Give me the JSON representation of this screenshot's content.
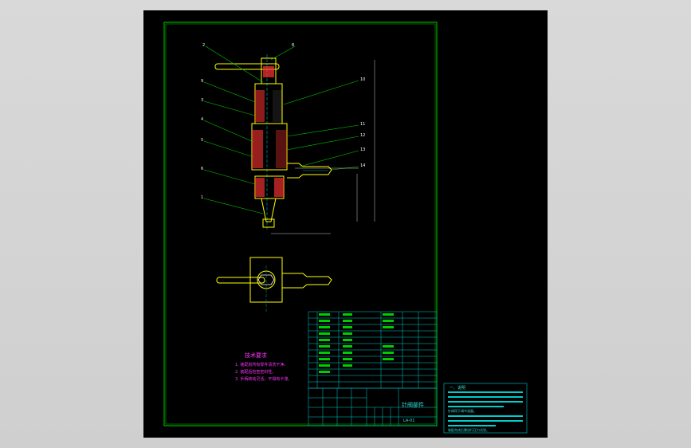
{
  "viewer": {
    "background": "#d4d4d4",
    "canvas_background": "#000000"
  },
  "colors": {
    "border": "#00cc00",
    "leader": "#00cc00",
    "part": "#ffff00",
    "hatch": "#ff3333",
    "text_magenta": "#ff33ff",
    "table": "#00cccc",
    "white": "#ffffff"
  },
  "title_block": {
    "drawing_name": "针阀部件",
    "drawing_number": "LA-01"
  },
  "notes": {
    "heading": "技术要求",
    "lines": [
      "1. 装配前所有零件清洗干净。",
      "2. 装配后检查密封性。",
      "3. 手柄转动灵活，不得有卡滞。"
    ]
  },
  "part_labels": [
    "2",
    "8",
    "9",
    "3",
    "4",
    "5",
    "6",
    "1",
    "10",
    "11",
    "12",
    "13",
    "14"
  ],
  "side_text": {
    "title": "一、说明",
    "lines": [
      "针阀用于调节流量。",
      "装配完成后需进行压力试验。"
    ]
  }
}
